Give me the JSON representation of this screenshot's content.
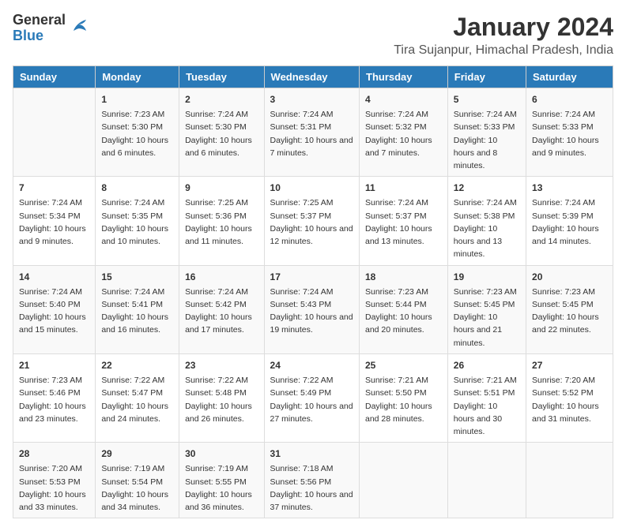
{
  "logo": {
    "general": "General",
    "blue": "Blue"
  },
  "title": "January 2024",
  "subtitle": "Tira Sujanpur, Himachal Pradesh, India",
  "days_of_week": [
    "Sunday",
    "Monday",
    "Tuesday",
    "Wednesday",
    "Thursday",
    "Friday",
    "Saturday"
  ],
  "weeks": [
    [
      {
        "day": "",
        "sunrise": "",
        "sunset": "",
        "daylight": ""
      },
      {
        "day": "1",
        "sunrise": "Sunrise: 7:23 AM",
        "sunset": "Sunset: 5:30 PM",
        "daylight": "Daylight: 10 hours and 6 minutes."
      },
      {
        "day": "2",
        "sunrise": "Sunrise: 7:24 AM",
        "sunset": "Sunset: 5:30 PM",
        "daylight": "Daylight: 10 hours and 6 minutes."
      },
      {
        "day": "3",
        "sunrise": "Sunrise: 7:24 AM",
        "sunset": "Sunset: 5:31 PM",
        "daylight": "Daylight: 10 hours and 7 minutes."
      },
      {
        "day": "4",
        "sunrise": "Sunrise: 7:24 AM",
        "sunset": "Sunset: 5:32 PM",
        "daylight": "Daylight: 10 hours and 7 minutes."
      },
      {
        "day": "5",
        "sunrise": "Sunrise: 7:24 AM",
        "sunset": "Sunset: 5:33 PM",
        "daylight": "Daylight: 10 hours and 8 minutes."
      },
      {
        "day": "6",
        "sunrise": "Sunrise: 7:24 AM",
        "sunset": "Sunset: 5:33 PM",
        "daylight": "Daylight: 10 hours and 9 minutes."
      }
    ],
    [
      {
        "day": "7",
        "sunrise": "Sunrise: 7:24 AM",
        "sunset": "Sunset: 5:34 PM",
        "daylight": "Daylight: 10 hours and 9 minutes."
      },
      {
        "day": "8",
        "sunrise": "Sunrise: 7:24 AM",
        "sunset": "Sunset: 5:35 PM",
        "daylight": "Daylight: 10 hours and 10 minutes."
      },
      {
        "day": "9",
        "sunrise": "Sunrise: 7:25 AM",
        "sunset": "Sunset: 5:36 PM",
        "daylight": "Daylight: 10 hours and 11 minutes."
      },
      {
        "day": "10",
        "sunrise": "Sunrise: 7:25 AM",
        "sunset": "Sunset: 5:37 PM",
        "daylight": "Daylight: 10 hours and 12 minutes."
      },
      {
        "day": "11",
        "sunrise": "Sunrise: 7:24 AM",
        "sunset": "Sunset: 5:37 PM",
        "daylight": "Daylight: 10 hours and 13 minutes."
      },
      {
        "day": "12",
        "sunrise": "Sunrise: 7:24 AM",
        "sunset": "Sunset: 5:38 PM",
        "daylight": "Daylight: 10 hours and 13 minutes."
      },
      {
        "day": "13",
        "sunrise": "Sunrise: 7:24 AM",
        "sunset": "Sunset: 5:39 PM",
        "daylight": "Daylight: 10 hours and 14 minutes."
      }
    ],
    [
      {
        "day": "14",
        "sunrise": "Sunrise: 7:24 AM",
        "sunset": "Sunset: 5:40 PM",
        "daylight": "Daylight: 10 hours and 15 minutes."
      },
      {
        "day": "15",
        "sunrise": "Sunrise: 7:24 AM",
        "sunset": "Sunset: 5:41 PM",
        "daylight": "Daylight: 10 hours and 16 minutes."
      },
      {
        "day": "16",
        "sunrise": "Sunrise: 7:24 AM",
        "sunset": "Sunset: 5:42 PM",
        "daylight": "Daylight: 10 hours and 17 minutes."
      },
      {
        "day": "17",
        "sunrise": "Sunrise: 7:24 AM",
        "sunset": "Sunset: 5:43 PM",
        "daylight": "Daylight: 10 hours and 19 minutes."
      },
      {
        "day": "18",
        "sunrise": "Sunrise: 7:23 AM",
        "sunset": "Sunset: 5:44 PM",
        "daylight": "Daylight: 10 hours and 20 minutes."
      },
      {
        "day": "19",
        "sunrise": "Sunrise: 7:23 AM",
        "sunset": "Sunset: 5:45 PM",
        "daylight": "Daylight: 10 hours and 21 minutes."
      },
      {
        "day": "20",
        "sunrise": "Sunrise: 7:23 AM",
        "sunset": "Sunset: 5:45 PM",
        "daylight": "Daylight: 10 hours and 22 minutes."
      }
    ],
    [
      {
        "day": "21",
        "sunrise": "Sunrise: 7:23 AM",
        "sunset": "Sunset: 5:46 PM",
        "daylight": "Daylight: 10 hours and 23 minutes."
      },
      {
        "day": "22",
        "sunrise": "Sunrise: 7:22 AM",
        "sunset": "Sunset: 5:47 PM",
        "daylight": "Daylight: 10 hours and 24 minutes."
      },
      {
        "day": "23",
        "sunrise": "Sunrise: 7:22 AM",
        "sunset": "Sunset: 5:48 PM",
        "daylight": "Daylight: 10 hours and 26 minutes."
      },
      {
        "day": "24",
        "sunrise": "Sunrise: 7:22 AM",
        "sunset": "Sunset: 5:49 PM",
        "daylight": "Daylight: 10 hours and 27 minutes."
      },
      {
        "day": "25",
        "sunrise": "Sunrise: 7:21 AM",
        "sunset": "Sunset: 5:50 PM",
        "daylight": "Daylight: 10 hours and 28 minutes."
      },
      {
        "day": "26",
        "sunrise": "Sunrise: 7:21 AM",
        "sunset": "Sunset: 5:51 PM",
        "daylight": "Daylight: 10 hours and 30 minutes."
      },
      {
        "day": "27",
        "sunrise": "Sunrise: 7:20 AM",
        "sunset": "Sunset: 5:52 PM",
        "daylight": "Daylight: 10 hours and 31 minutes."
      }
    ],
    [
      {
        "day": "28",
        "sunrise": "Sunrise: 7:20 AM",
        "sunset": "Sunset: 5:53 PM",
        "daylight": "Daylight: 10 hours and 33 minutes."
      },
      {
        "day": "29",
        "sunrise": "Sunrise: 7:19 AM",
        "sunset": "Sunset: 5:54 PM",
        "daylight": "Daylight: 10 hours and 34 minutes."
      },
      {
        "day": "30",
        "sunrise": "Sunrise: 7:19 AM",
        "sunset": "Sunset: 5:55 PM",
        "daylight": "Daylight: 10 hours and 36 minutes."
      },
      {
        "day": "31",
        "sunrise": "Sunrise: 7:18 AM",
        "sunset": "Sunset: 5:56 PM",
        "daylight": "Daylight: 10 hours and 37 minutes."
      },
      {
        "day": "",
        "sunrise": "",
        "sunset": "",
        "daylight": ""
      },
      {
        "day": "",
        "sunrise": "",
        "sunset": "",
        "daylight": ""
      },
      {
        "day": "",
        "sunrise": "",
        "sunset": "",
        "daylight": ""
      }
    ]
  ]
}
